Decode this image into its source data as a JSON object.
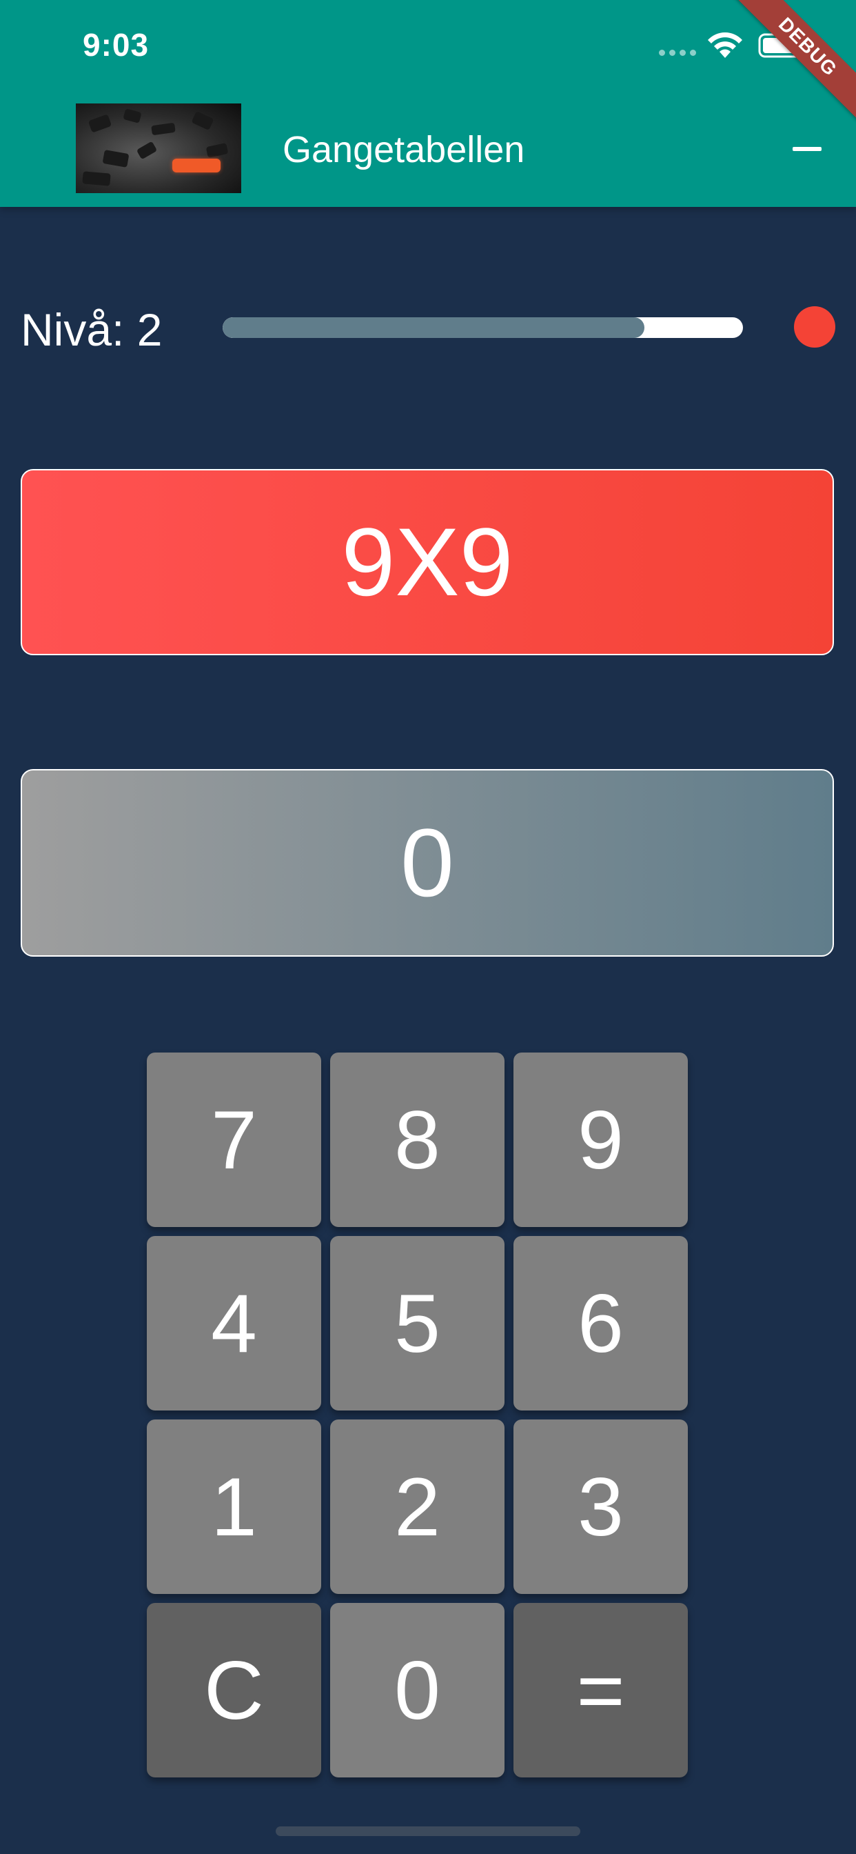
{
  "status_bar": {
    "time": "9:03"
  },
  "debug_banner": "DEBUG",
  "app_bar": {
    "title": "Gangetabellen",
    "image_icon": "numbers-image",
    "action_icon": "minus-icon"
  },
  "level": {
    "label": "Nivå: 2",
    "progress": 0.81,
    "indicator_color": "#f44336"
  },
  "question": {
    "text": "9X9"
  },
  "answer": {
    "text": "0"
  },
  "keypad": {
    "keys": [
      {
        "label": "7",
        "style": "normal"
      },
      {
        "label": "8",
        "style": "normal"
      },
      {
        "label": "9",
        "style": "normal"
      },
      {
        "label": "4",
        "style": "normal"
      },
      {
        "label": "5",
        "style": "normal"
      },
      {
        "label": "6",
        "style": "normal"
      },
      {
        "label": "1",
        "style": "normal"
      },
      {
        "label": "2",
        "style": "normal"
      },
      {
        "label": "3",
        "style": "normal"
      },
      {
        "label": "C",
        "style": "dark"
      },
      {
        "label": "0",
        "style": "normal"
      },
      {
        "label": "=",
        "style": "dark"
      }
    ]
  },
  "colors": {
    "background": "#1b2f4b",
    "app_bar": "#009688",
    "question_gradient": [
      "#ff5252",
      "#f44336"
    ],
    "answer_gradient": [
      "#9e9e9e",
      "#607d8b"
    ],
    "key": "#808080",
    "key_dark": "#616161"
  }
}
